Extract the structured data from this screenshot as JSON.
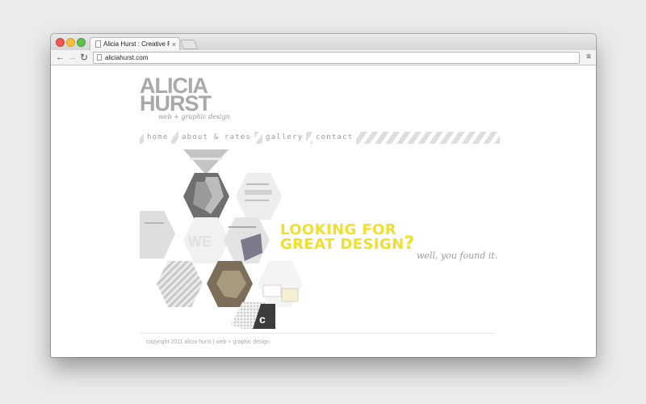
{
  "browser": {
    "tab_title": "Alicia Hurst : Creative Portfolio",
    "tab_close": "×",
    "address": "aliciahurst.com",
    "back": "←",
    "forward": "→",
    "reload": "↻",
    "menu": "≡"
  },
  "site": {
    "logo_line1": "ALICIA",
    "logo_line2": "HURST",
    "logo_tagline": "web + graphic design",
    "nav": [
      "home",
      "about & rates",
      "gallery",
      "contact"
    ],
    "headline_line1": "LOOKING FOR",
    "headline_line2": "GREAT DESIGN",
    "headline_q": "?",
    "subline": "well, you found it.",
    "footer": "copyright 2011 alicia hurst | web + graphic design"
  },
  "colors": {
    "accent_yellow": "#f2df2b",
    "text_gray": "#a9a9a9"
  }
}
